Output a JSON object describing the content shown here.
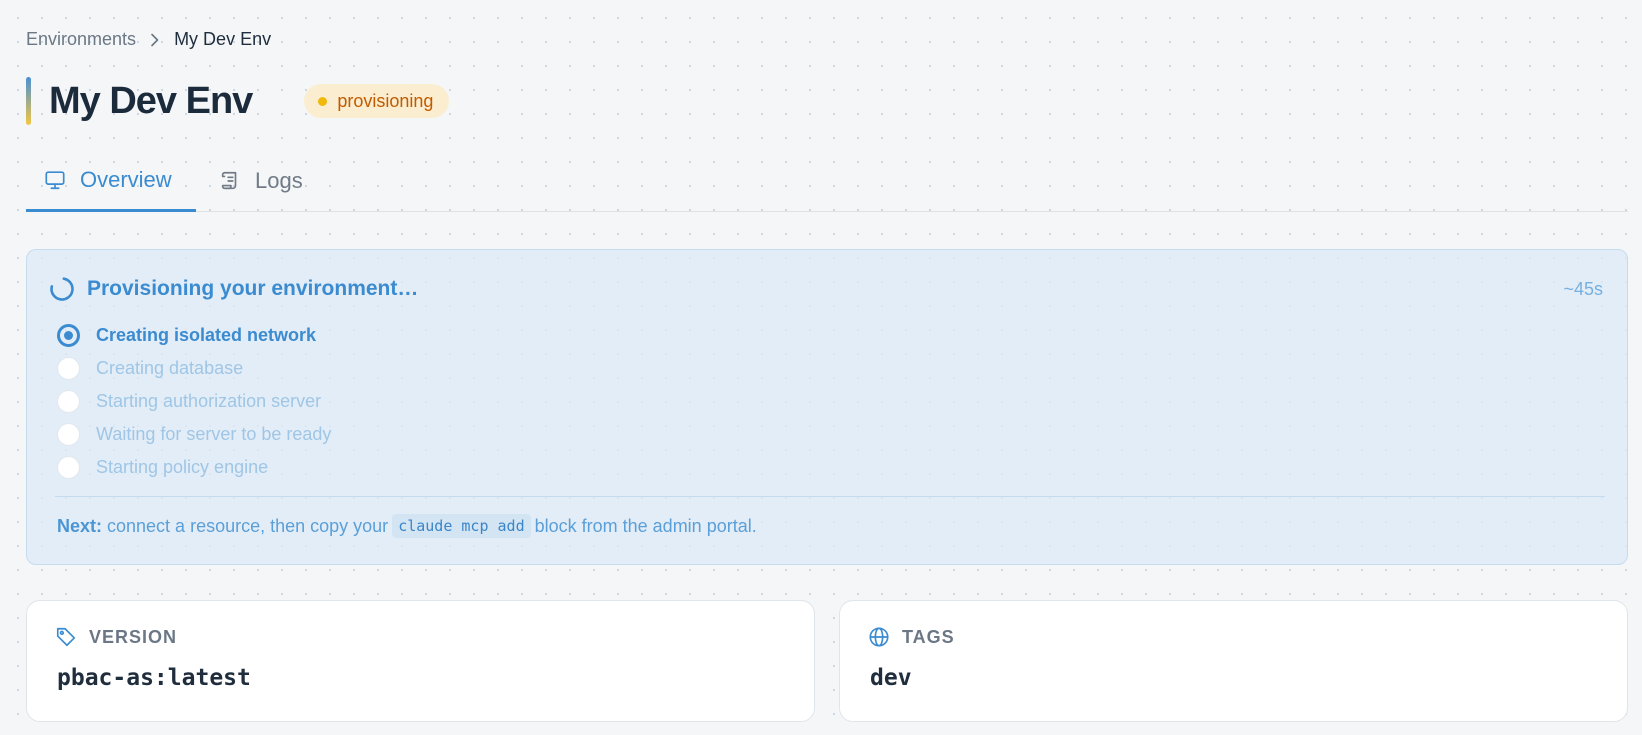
{
  "breadcrumb": {
    "parent": "Environments",
    "current": "My Dev Env"
  },
  "header": {
    "title": "My Dev Env",
    "status": "provisioning",
    "status_color": "#f0b90b"
  },
  "tabs": [
    {
      "label": "Overview",
      "icon": "monitor-icon",
      "active": true
    },
    {
      "label": "Logs",
      "icon": "scroll-icon",
      "active": false
    }
  ],
  "provisioning": {
    "title": "Provisioning your environment…",
    "eta": "~45s",
    "steps": [
      {
        "label": "Creating isolated network",
        "state": "active"
      },
      {
        "label": "Creating database",
        "state": "pending"
      },
      {
        "label": "Starting authorization server",
        "state": "pending"
      },
      {
        "label": "Waiting for server to be ready",
        "state": "pending"
      },
      {
        "label": "Starting policy engine",
        "state": "pending"
      }
    ],
    "next": {
      "label": "Next:",
      "before": "connect a resource, then copy your",
      "code": "claude mcp add",
      "after": "block from the admin portal."
    }
  },
  "cards": {
    "version": {
      "label": "VERSION",
      "icon": "tag-icon",
      "value": "pbac-as:latest"
    },
    "tags": {
      "label": "TAGS",
      "icon": "globe-icon",
      "value": "dev"
    }
  },
  "colors": {
    "accent": "#3b8bd0",
    "badge_text": "#c25a00",
    "badge_bg": "#fbeed0"
  }
}
